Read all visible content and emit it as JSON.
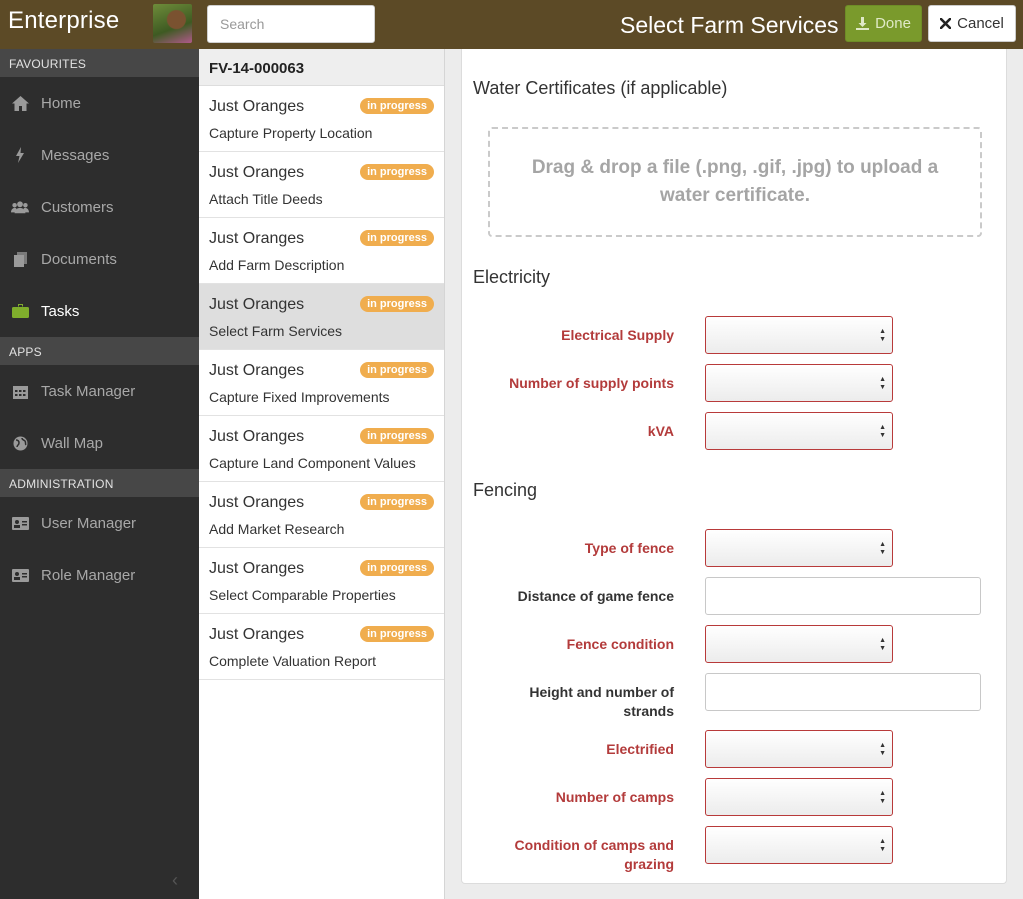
{
  "topbar": {
    "brand": "Enterprise",
    "search_placeholder": "Search",
    "page_title": "Select Farm Services",
    "done_label": "Done",
    "cancel_label": "Cancel"
  },
  "sidebar": {
    "sections": [
      {
        "title": "FAVOURITES",
        "items": [
          {
            "label": "Home",
            "icon": "home-icon"
          },
          {
            "label": "Messages",
            "icon": "bolt-icon"
          },
          {
            "label": "Customers",
            "icon": "users-icon"
          },
          {
            "label": "Documents",
            "icon": "document-icon"
          },
          {
            "label": "Tasks",
            "icon": "briefcase-icon",
            "active": true
          }
        ]
      },
      {
        "title": "APPS",
        "items": [
          {
            "label": "Task Manager",
            "icon": "calendar-icon"
          },
          {
            "label": "Wall Map",
            "icon": "globe-icon"
          }
        ]
      },
      {
        "title": "ADMINISTRATION",
        "items": [
          {
            "label": "User Manager",
            "icon": "id-card-icon"
          },
          {
            "label": "Role Manager",
            "icon": "id-card-icon"
          }
        ]
      }
    ]
  },
  "tasklist": {
    "header": "FV-14-000063",
    "tasks": [
      {
        "name": "Just Oranges",
        "status": "in progress",
        "sub": "Capture Property Location"
      },
      {
        "name": "Just Oranges",
        "status": "in progress",
        "sub": "Attach Title Deeds"
      },
      {
        "name": "Just Oranges",
        "status": "in progress",
        "sub": "Add Farm Description"
      },
      {
        "name": "Just Oranges",
        "status": "in progress",
        "sub": "Select Farm Services",
        "selected": true
      },
      {
        "name": "Just Oranges",
        "status": "in progress",
        "sub": "Capture Fixed Improvements"
      },
      {
        "name": "Just Oranges",
        "status": "in progress",
        "sub": "Capture Land Component Values"
      },
      {
        "name": "Just Oranges",
        "status": "in progress",
        "sub": "Add Market Research"
      },
      {
        "name": "Just Oranges",
        "status": "in progress",
        "sub": "Select Comparable Properties"
      },
      {
        "name": "Just Oranges",
        "status": "in progress",
        "sub": "Complete Valuation Report"
      }
    ]
  },
  "form": {
    "water": {
      "heading": "Water Certificates (if applicable)",
      "dropzone": "Drag & drop a file (.png, .gif, .jpg) to upload a water certificate."
    },
    "electricity": {
      "heading": "Electricity",
      "fields": {
        "supply": {
          "label": "Electrical Supply",
          "value": ""
        },
        "points": {
          "label": "Number of supply points",
          "value": ""
        },
        "kva": {
          "label": "kVA",
          "value": ""
        }
      }
    },
    "fencing": {
      "heading": "Fencing",
      "fields": {
        "type": {
          "label": "Type of fence",
          "value": ""
        },
        "distance": {
          "label": "Distance of game fence",
          "value": ""
        },
        "condition": {
          "label": "Fence condition",
          "value": ""
        },
        "height": {
          "label": "Height and number of strands",
          "value": ""
        },
        "electrified": {
          "label": "Electrified",
          "value": ""
        },
        "camps": {
          "label": "Number of camps",
          "value": ""
        },
        "grazing": {
          "label": "Condition of camps and grazing",
          "value": ""
        }
      }
    }
  },
  "colors": {
    "topbar": "#5c4a26",
    "sidebar": "#2d2d2d",
    "done_button": "#7a9a2c",
    "badge": "#f0ad4e",
    "required_label": "#b33b3b"
  }
}
